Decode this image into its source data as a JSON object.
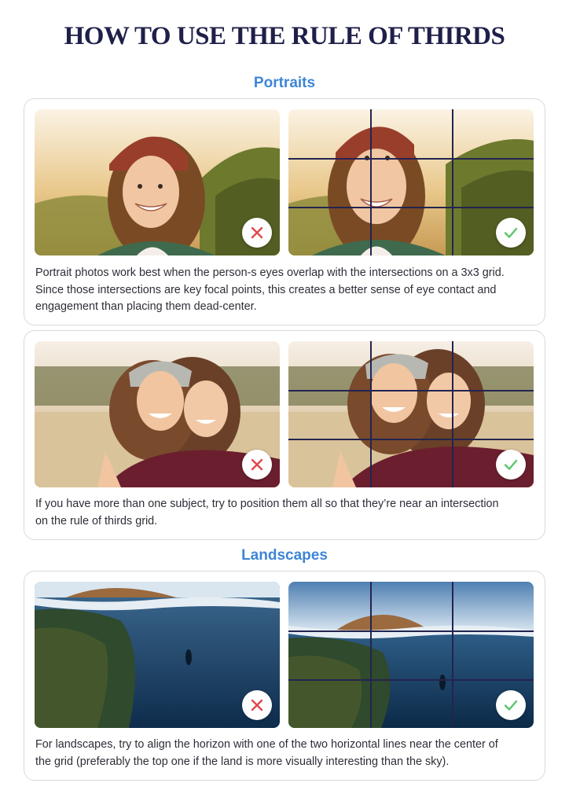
{
  "page": {
    "title": "HOW TO USE THE RULE OF THIRDS"
  },
  "sections": {
    "portraits": {
      "heading": "Portraits"
    },
    "landscapes": {
      "heading": "Landscapes"
    }
  },
  "cards": {
    "portrait_single": {
      "caption_lines": [
        "Portrait photos work best when the person-s eyes overlap with the intersections on a 3x3 grid.",
        "Since those intersections are key focal points, this creates a better sense of eye contact and",
        "engagement than placing them dead-center."
      ],
      "bad_photo": {
        "subject": "woman in red knit beanie smiling, centered",
        "verdict": "incorrect"
      },
      "good_photo": {
        "subject": "woman in red knit beanie smiling, eyes on grid intersection",
        "verdict": "correct"
      }
    },
    "portrait_group": {
      "caption_lines": [
        "If you have more than one subject, try to position them all so that they’re near an intersection",
        "on the rule of thirds grid."
      ],
      "bad_photo": {
        "subject": "two women hugging outdoors, centered",
        "verdict": "incorrect"
      },
      "good_photo": {
        "subject": "two women hugging outdoors, near grid intersections",
        "verdict": "correct"
      }
    },
    "landscape": {
      "caption_lines": [
        "For landscapes, try to align the horizon with one of the two horizontal lines near the center of",
        "the grid (preferably the top one if the land is more visually interesting than the sky)."
      ],
      "bad_photo": {
        "subject": "split-level ocean view with diver, horizon near top",
        "verdict": "incorrect"
      },
      "good_photo": {
        "subject": "split-level ocean view with diver, horizon on upper third line",
        "verdict": "correct"
      }
    }
  },
  "icons": {
    "incorrect": "x-mark-icon",
    "correct": "check-mark-icon"
  },
  "colors": {
    "title": "#1f2049",
    "section_heading": "#3d86d6",
    "grid_line": "#23244f",
    "incorrect_mark": "#e0474c",
    "correct_mark": "#5cc46a",
    "card_border": "#d9d9e0"
  }
}
